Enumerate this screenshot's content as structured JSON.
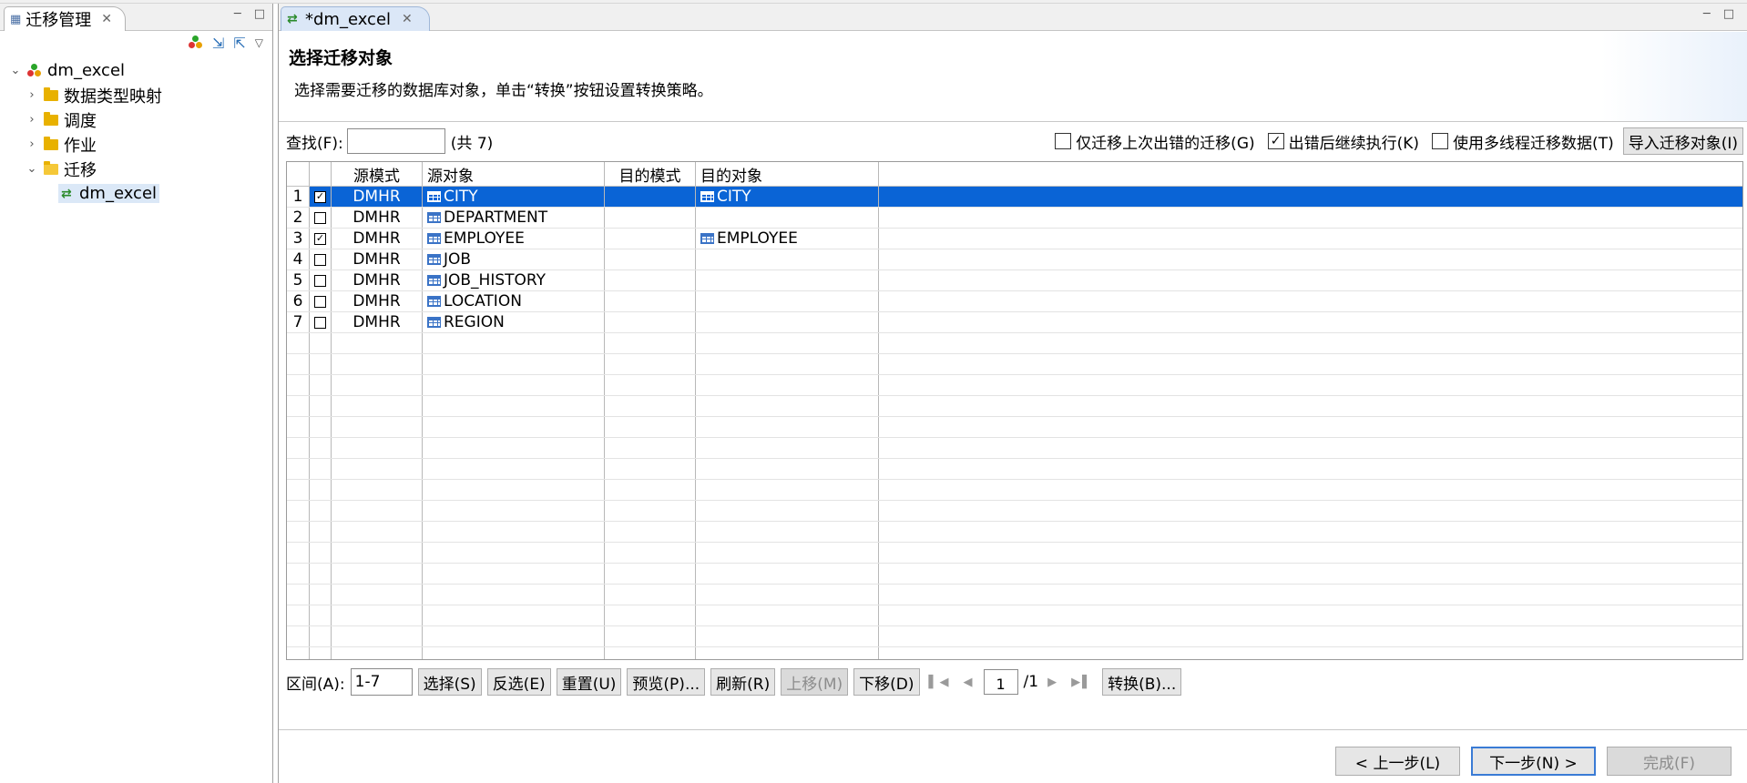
{
  "left_panel": {
    "tab_title": "迁移管理",
    "tree": {
      "root": "dm_excel",
      "children": [
        "数据类型映射",
        "调度",
        "作业",
        "迁移"
      ],
      "migration_child": "dm_excel"
    }
  },
  "editor": {
    "tab_title": "*dm_excel",
    "page_title": "选择迁移对象",
    "page_desc": "选择需要迁移的数据库对象，单击“转换”按钮设置转换策略。",
    "search": {
      "label": "查找(F):",
      "value": "",
      "count": "(共 7)"
    },
    "options": {
      "only_failed": {
        "label": "仅迁移上次出错的迁移(G)",
        "checked": false
      },
      "continue_on_error": {
        "label": "出错后继续执行(K)",
        "checked": true
      },
      "multithread": {
        "label": "使用多线程迁移数据(T)",
        "checked": false
      }
    },
    "import_button": "导入迁移对象(I)",
    "table": {
      "columns": [
        "源模式",
        "源对象",
        "目的模式",
        "目的对象"
      ],
      "rows": [
        {
          "num": "1",
          "checked": true,
          "schema": "DMHR",
          "source": "CITY",
          "dest_schema": "",
          "dest": "CITY",
          "selected": true
        },
        {
          "num": "2",
          "checked": false,
          "schema": "DMHR",
          "source": "DEPARTMENT",
          "dest_schema": "",
          "dest": "",
          "selected": false
        },
        {
          "num": "3",
          "checked": true,
          "schema": "DMHR",
          "source": "EMPLOYEE",
          "dest_schema": "",
          "dest": "EMPLOYEE",
          "selected": false
        },
        {
          "num": "4",
          "checked": false,
          "schema": "DMHR",
          "source": "JOB",
          "dest_schema": "",
          "dest": "",
          "selected": false
        },
        {
          "num": "5",
          "checked": false,
          "schema": "DMHR",
          "source": "JOB_HISTORY",
          "dest_schema": "",
          "dest": "",
          "selected": false
        },
        {
          "num": "6",
          "checked": false,
          "schema": "DMHR",
          "source": "LOCATION",
          "dest_schema": "",
          "dest": "",
          "selected": false
        },
        {
          "num": "7",
          "checked": false,
          "schema": "DMHR",
          "source": "REGION",
          "dest_schema": "",
          "dest": "",
          "selected": false
        }
      ]
    },
    "range": {
      "label": "区间(A):",
      "value": "1-7"
    },
    "action_buttons": {
      "select": "选择(S)",
      "invert": "反选(E)",
      "reset": "重置(U)",
      "preview": "预览(P)...",
      "refresh": "刷新(R)",
      "move_up": "上移(M)",
      "move_down": "下移(D)",
      "convert": "转换(B)..."
    },
    "pagination": {
      "current": "1",
      "total": "/1"
    },
    "footer": {
      "prev": "< 上一步(L)",
      "next": "下一步(N) >",
      "finish": "完成(F)"
    }
  },
  "colors": {
    "selection": "#0a64d6",
    "folder": "#e8b100",
    "table_icon": "#3a73c6"
  }
}
